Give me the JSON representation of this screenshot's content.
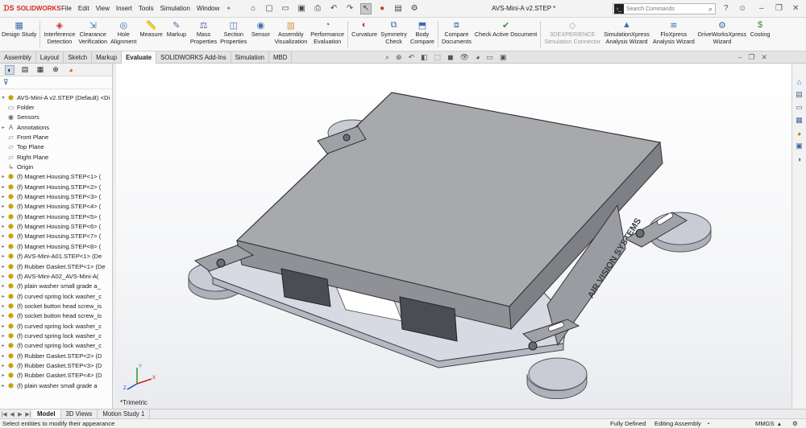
{
  "app": {
    "brand": "SOLIDWORKS",
    "document_title": "AVS-Mini-A v2.STEP *"
  },
  "menu": [
    "File",
    "Edit",
    "View",
    "Insert",
    "Tools",
    "Simulation",
    "Window"
  ],
  "search": {
    "placeholder": "Search Commands"
  },
  "ribbon": [
    {
      "label": "Design Study",
      "icon": "design-study-icon"
    },
    {
      "label": "Interference\nDetection",
      "icon": "interference-icon"
    },
    {
      "label": "Clearance\nVerification",
      "icon": "clearance-icon"
    },
    {
      "label": "Hole\nAlignment",
      "icon": "hole-alignment-icon"
    },
    {
      "label": "Measure",
      "icon": "measure-icon"
    },
    {
      "label": "Markup",
      "icon": "markup-icon"
    },
    {
      "label": "Mass\nProperties",
      "icon": "mass-properties-icon"
    },
    {
      "label": "Section\nProperties",
      "icon": "section-properties-icon"
    },
    {
      "label": "Sensor",
      "icon": "sensor-icon"
    },
    {
      "label": "Assembly\nVisualization",
      "icon": "assembly-visualization-icon"
    },
    {
      "label": "Performance\nEvaluation",
      "icon": "performance-icon"
    },
    {
      "label": "Curvature",
      "icon": "curvature-icon"
    },
    {
      "label": "Symmetry\nCheck",
      "icon": "symmetry-icon"
    },
    {
      "label": "Body\nCompare",
      "icon": "body-compare-icon"
    },
    {
      "label": "Compare\nDocuments",
      "icon": "compare-documents-icon"
    },
    {
      "label": "Check Active Document",
      "icon": "check-document-icon"
    },
    {
      "label": "3DEXPERIENCE\nSimulation Connector",
      "icon": "3dx-connector-icon",
      "disabled": true
    },
    {
      "label": "SimulationXpress\nAnalysis Wizard",
      "icon": "simulationxpress-icon"
    },
    {
      "label": "FloXpress\nAnalysis Wizard",
      "icon": "floxpress-icon"
    },
    {
      "label": "DriveWorksXpress\nWizard",
      "icon": "driveworks-icon"
    },
    {
      "label": "Costing",
      "icon": "costing-icon"
    }
  ],
  "tabs": [
    "Assembly",
    "Layout",
    "Sketch",
    "Markup",
    "Evaluate",
    "SOLIDWORKS Add-Ins",
    "Simulation",
    "MBD"
  ],
  "active_tab": "Evaluate",
  "tree": {
    "root": "AVS-Mini-A v2.STEP (Default) <Di",
    "items": [
      {
        "label": "Folder",
        "icon": "folder"
      },
      {
        "label": "Sensors",
        "icon": "sensor"
      },
      {
        "label": "Annotations",
        "icon": "annotation",
        "expand": true
      },
      {
        "label": "Front Plane",
        "icon": "plane"
      },
      {
        "label": "Top Plane",
        "icon": "plane"
      },
      {
        "label": "Right Plane",
        "icon": "plane"
      },
      {
        "label": "Origin",
        "icon": "origin"
      },
      {
        "label": "(f) Magnet Housing.STEP<1> (",
        "icon": "part",
        "expand": true
      },
      {
        "label": "(f) Magnet Housing.STEP<2> (",
        "icon": "part",
        "expand": true
      },
      {
        "label": "(f) Magnet Housing.STEP<3> (",
        "icon": "part",
        "expand": true
      },
      {
        "label": "(f) Magnet Housing.STEP<4> (",
        "icon": "part",
        "expand": true
      },
      {
        "label": "(f) Magnet Housing.STEP<5> (",
        "icon": "part",
        "expand": true
      },
      {
        "label": "(f) Magnet Housing.STEP<6> (",
        "icon": "part",
        "expand": true
      },
      {
        "label": "(f) Magnet Housing.STEP<7> (",
        "icon": "part",
        "expand": true
      },
      {
        "label": "(f) Magnet Housing.STEP<8> (",
        "icon": "part",
        "expand": true
      },
      {
        "label": "(f) AVS-Mini-A01.STEP<1> (De",
        "icon": "asm",
        "expand": true
      },
      {
        "label": "(f) Rubber Gasket.STEP<1> (De",
        "icon": "part",
        "expand": true
      },
      {
        "label": "(f) AVS-Mini-A02_AVS-Mini-A(",
        "icon": "asm",
        "expand": true
      },
      {
        "label": "(f) plain washer small grade a_",
        "icon": "part",
        "expand": true
      },
      {
        "label": "(f) curved spring lock washer_c",
        "icon": "part",
        "expand": true
      },
      {
        "label": "(f) socket button head screw_is",
        "icon": "part",
        "expand": true
      },
      {
        "label": "(f) socket button head screw_is",
        "icon": "part",
        "expand": true
      },
      {
        "label": "(f) curved spring lock washer_c",
        "icon": "part",
        "expand": true
      },
      {
        "label": "(f) curved spring lock washer_c",
        "icon": "part",
        "expand": true
      },
      {
        "label": "(f) curved spring lock washer_c",
        "icon": "part",
        "expand": true
      },
      {
        "label": "(f) Rubber Gasket.STEP<2> (D",
        "icon": "part",
        "expand": true
      },
      {
        "label": "(f) Rubber Gasket.STEP<3> (D",
        "icon": "part",
        "expand": true
      },
      {
        "label": "(f) Rubber Gasket.STEP<4> (D",
        "icon": "part",
        "expand": true
      },
      {
        "label": "(f) plain washer small grade a",
        "icon": "part",
        "expand": true
      }
    ]
  },
  "viewport": {
    "view_label": "*Trimetric",
    "emboss_text": "AIR VISION SYSTEMS"
  },
  "bottom_tabs": [
    "Model",
    "3D Views",
    "Motion Study 1"
  ],
  "active_bottom_tab": "Model",
  "status": {
    "message": "Select entities to modify their appearance",
    "definition": "Fully Defined",
    "mode": "Editing Assembly",
    "units": "MMGS"
  }
}
